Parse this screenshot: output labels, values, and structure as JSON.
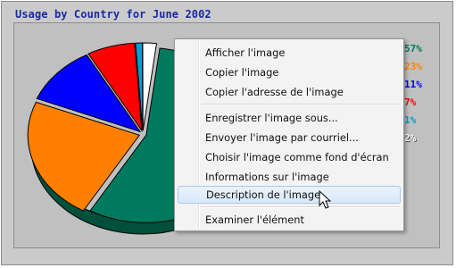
{
  "chart": {
    "title": "Usage by Country for June 2002",
    "legend": [
      {
        "label": "57%",
        "color": "#007a5e"
      },
      {
        "label": "23%",
        "color": "#ff8000"
      },
      {
        "label": "11%",
        "color": "#0000ff"
      },
      {
        "label": "7%",
        "color": "#ff0000"
      },
      {
        "label": "1%",
        "color": "#00a0d0"
      },
      {
        "label": "2%",
        "color": "#ffffff"
      }
    ]
  },
  "chart_data": {
    "type": "pie",
    "title": "Usage by Country for June 2002",
    "values": [
      57,
      23,
      11,
      7,
      1,
      2
    ],
    "labels": [
      "57%",
      "23%",
      "11%",
      "7%",
      "1%",
      "2%"
    ],
    "colors": [
      "#007a5e",
      "#ff8000",
      "#0000ff",
      "#ff0000",
      "#00a0d0",
      "#ffffff"
    ]
  },
  "context_menu": {
    "items": [
      {
        "label": "Afficher l'image",
        "highlighted": false
      },
      {
        "label": "Copier l'image",
        "highlighted": false
      },
      {
        "label": "Copier l'adresse de l'image",
        "highlighted": false
      },
      {
        "label": "Enregistrer l'image sous...",
        "highlighted": false
      },
      {
        "label": "Envoyer l'image par courriel...",
        "highlighted": false
      },
      {
        "label": "Choisir l'image comme fond d'écran",
        "highlighted": false
      },
      {
        "label": "Informations sur l'image",
        "highlighted": false
      },
      {
        "label": "Description de l'image",
        "highlighted": true
      },
      {
        "label": "Examiner l'élément",
        "highlighted": false
      }
    ]
  }
}
